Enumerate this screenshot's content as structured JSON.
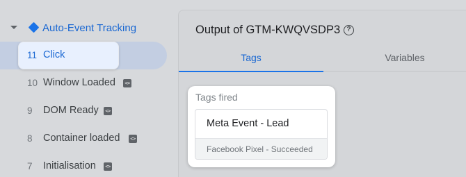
{
  "timeline": {
    "group_title": "Auto-Event Tracking",
    "events": [
      {
        "number": "11",
        "label": "Click",
        "selected": true,
        "badge": false
      },
      {
        "number": "10",
        "label": "Window Loaded",
        "selected": false,
        "badge": true
      },
      {
        "number": "9",
        "label": "DOM Ready",
        "selected": false,
        "badge": true
      },
      {
        "number": "8",
        "label": "Container loaded",
        "selected": false,
        "badge": true
      },
      {
        "number": "7",
        "label": "Initialisation",
        "selected": false,
        "badge": true
      }
    ],
    "badge_glyph": "<>",
    "colors": {
      "accent": "#1967d2",
      "selected_bg": "#c3cee2"
    }
  },
  "output": {
    "title": "Output of GTM-KWQVSDP3",
    "help_glyph": "?",
    "tabs": [
      {
        "label": "Tags",
        "active": true
      },
      {
        "label": "Variables",
        "active": false
      }
    ],
    "tags_fired": {
      "heading": "Tags fired",
      "tag": {
        "name": "Meta Event - Lead",
        "status": "Facebook Pixel - Succeeded"
      }
    }
  }
}
